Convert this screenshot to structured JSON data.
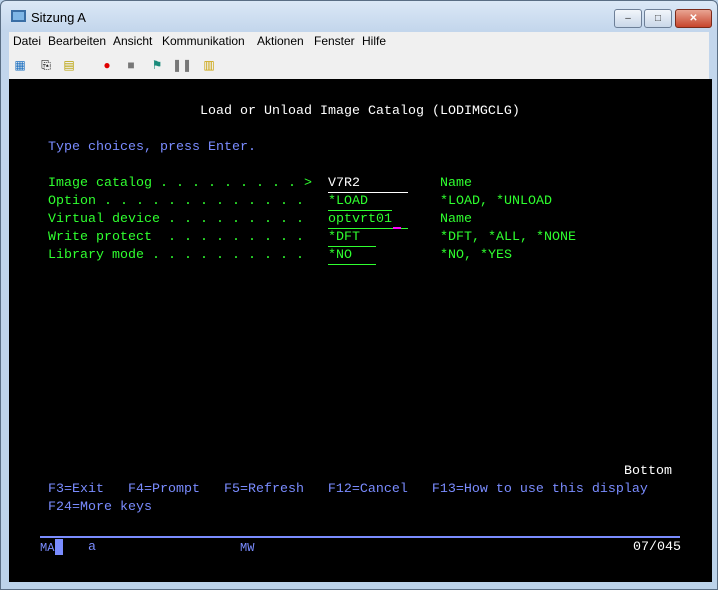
{
  "window": {
    "title": "Sitzung A",
    "min": "–",
    "max": "□",
    "close": "✕"
  },
  "menu": [
    "Datei",
    "Bearbeiten",
    "Ansicht",
    "Kommunikation",
    "Aktionen",
    "Fenster",
    "Hilfe"
  ],
  "toolbar": [
    "copy-screen-icon",
    "copy-icon",
    "paste-icon",
    "record-macro-icon",
    "stop-macro-icon",
    "play-macro-icon",
    "pause-macro-icon",
    "notes-icon"
  ],
  "screen": {
    "title": "Load or Unload Image Catalog (LODIMGCLG)",
    "instructions": "Type choices, press Enter.",
    "fields": [
      {
        "label": "Image catalog . . . . . . . . . >",
        "value": "V7R2      ",
        "hint": "Name"
      },
      {
        "label": "Option . . . . . . . . . . . . .",
        "value": "*LOAD   ",
        "hint": "*LOAD, *UNLOAD"
      },
      {
        "label": "Virtual device . . . . . . . . .",
        "value": "optvrt01  ",
        "hint": "Name"
      },
      {
        "label": "Write protect  . . . . . . . . .",
        "value": "*DFT  ",
        "hint": "*DFT, *ALL, *NONE"
      },
      {
        "label": "Library mode . . . . . . . . . .",
        "value": "*NO   ",
        "hint": "*NO, *YES"
      }
    ],
    "bottom": "Bottom",
    "fkeys1": "F3=Exit   F4=Prompt   F5=Refresh   F12=Cancel   F13=How to use this display",
    "fkeys2": "F24=More keys"
  },
  "status": {
    "mode": "MA",
    "shift": "a",
    "mw": "MW",
    "position": "07/045"
  }
}
